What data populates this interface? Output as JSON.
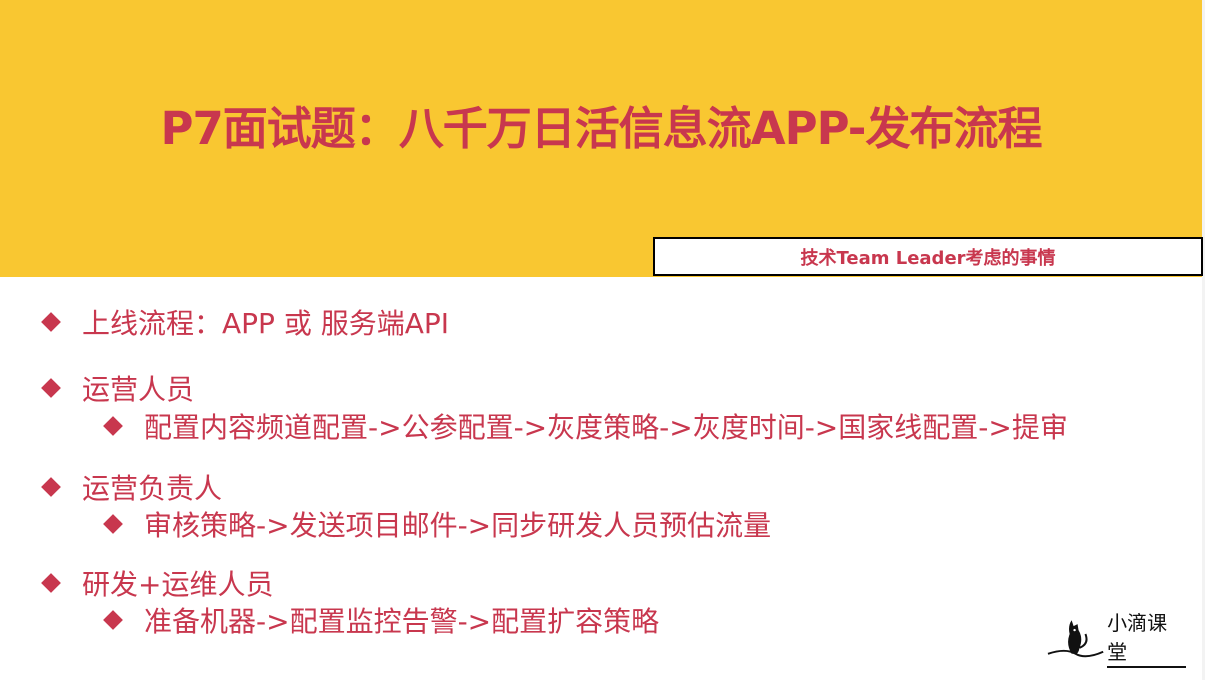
{
  "title": "P7面试题：八千万日活信息流APP-发布流程",
  "tag": "技术Team Leader考虑的事情",
  "items": [
    {
      "text": "上线流程：APP 或 服务端API"
    },
    {
      "text": "运营人员",
      "sub": "配置内容频道配置->公参配置->灰度策略->灰度时间->国家线配置->提审"
    },
    {
      "text": "运营负责人",
      "sub": "审核策略->发送项目邮件->同步研发人员预估流量"
    },
    {
      "text": "研发+运维人员",
      "sub": "准备机器->配置监控告警->配置扩容策略"
    }
  ],
  "logo": {
    "text": "小滴课堂",
    "icon": "cat-silhouette-icon"
  },
  "colors": {
    "band": "#f9c731",
    "accent": "#c8374e"
  }
}
